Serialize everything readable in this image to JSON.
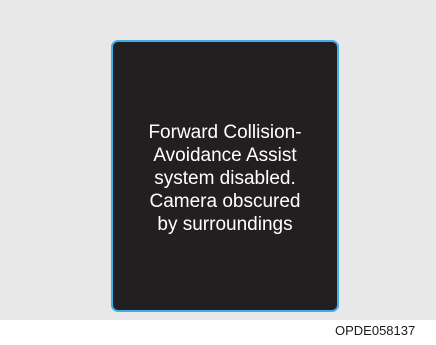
{
  "display": {
    "message": "Forward Collision-\nAvoidance Assist\nsystem disabled.\nCamera obscured\nby surroundings"
  },
  "figure": {
    "code": "OPDE058137"
  },
  "colors": {
    "background": "#e8e8e8",
    "screen": "#231f20",
    "screen_border": "#3eb0e6",
    "text": "#ffffff"
  }
}
